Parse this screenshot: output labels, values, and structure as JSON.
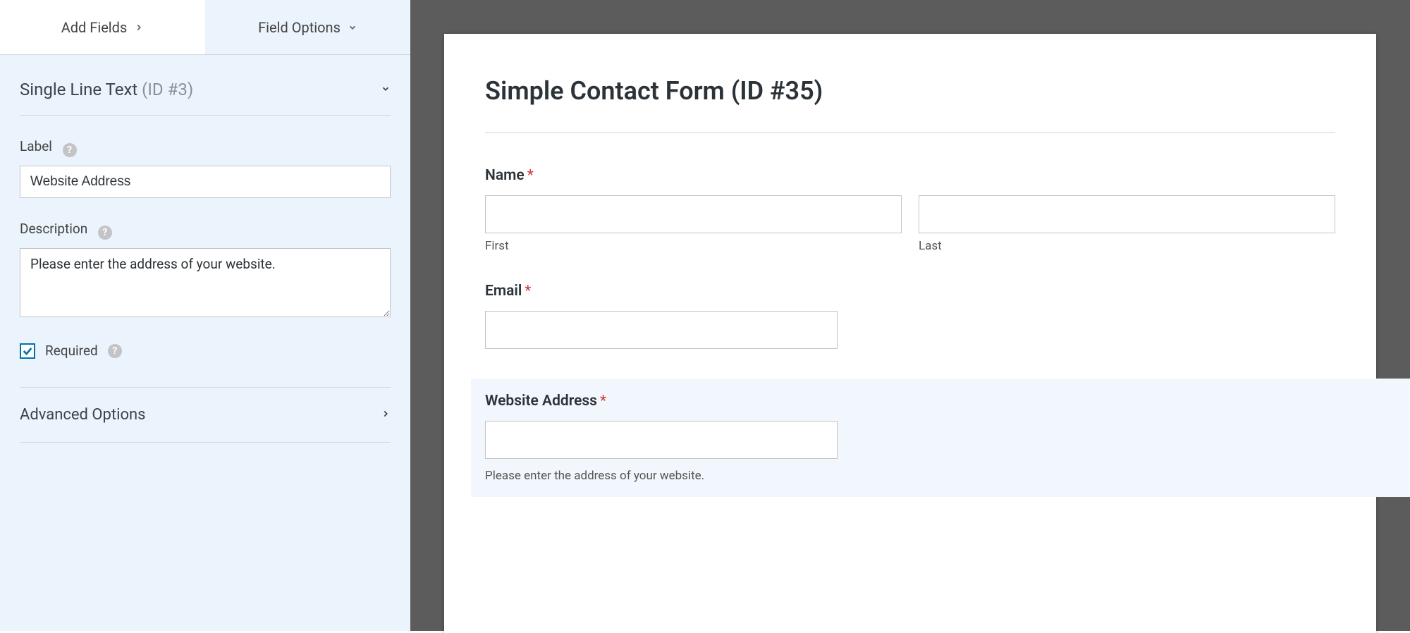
{
  "tabs": {
    "add_fields": "Add Fields",
    "field_options": "Field Options"
  },
  "field_header": {
    "type_name": "Single Line Text",
    "id_label": "(ID #3)"
  },
  "options": {
    "label_label": "Label",
    "label_value": "Website Address",
    "description_label": "Description",
    "description_value": "Please enter the address of your website.",
    "required_label": "Required"
  },
  "advanced": {
    "title": "Advanced Options"
  },
  "preview": {
    "form_title": "Simple Contact Form (ID #35)",
    "fields": {
      "name": {
        "label": "Name",
        "required": true,
        "first": "First",
        "last": "Last"
      },
      "email": {
        "label": "Email",
        "required": true
      },
      "website": {
        "label": "Website Address",
        "required": true,
        "description": "Please enter the address of your website."
      }
    }
  }
}
